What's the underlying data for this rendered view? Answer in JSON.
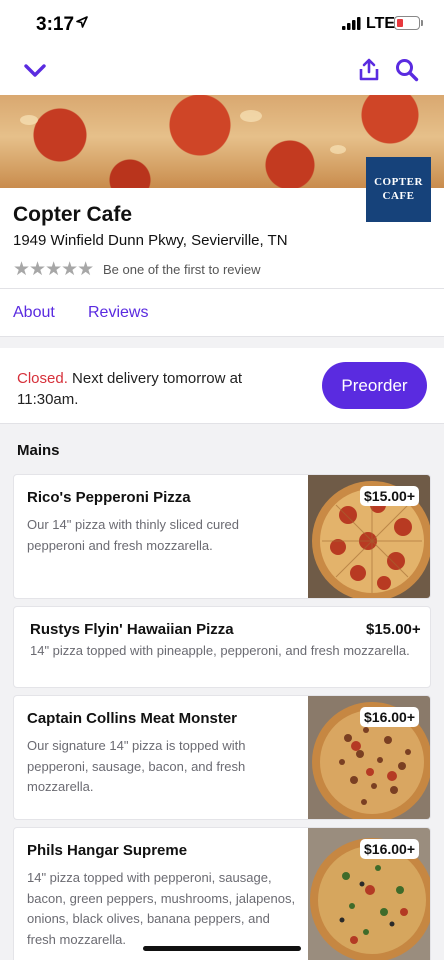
{
  "status_bar": {
    "time": "3:17",
    "network": "LTE",
    "battery_color": "#e8383d"
  },
  "nav": {
    "back_icon": "chevron-down-icon",
    "share_icon": "share-icon",
    "search_icon": "search-icon"
  },
  "restaurant": {
    "name": "Copter Cafe",
    "address": "1949 Winfield Dunn Pkwy, Sevierville, TN",
    "stars_display": "★★★★★",
    "rating_filled": 0,
    "rating_max": 5,
    "review_cta": "Be one of the first to review",
    "logo_line1": "COPTER",
    "logo_line2": "CAFE"
  },
  "tabs": [
    {
      "label": "About"
    },
    {
      "label": "Reviews"
    }
  ],
  "delivery": {
    "status": "Closed.",
    "message": " Next delivery tomorrow at 11:30am.",
    "cta": "Preorder"
  },
  "menu": {
    "section": "Mains",
    "items": [
      {
        "name": "Rico's Pepperoni Pizza",
        "description": "Our 14\" pizza with thinly sliced cured pepperoni and fresh mozzarella.",
        "price": "$15.00+"
      },
      {
        "name": "Rustys Flyin' Hawaiian Pizza",
        "description": "14\" pizza topped with pineapple, pepperoni, and fresh mozzarella.",
        "price": "$15.00+"
      },
      {
        "name": "Captain Collins Meat Monster",
        "description": "Our signature 14\" pizza is topped with pepperoni, sausage, bacon, and fresh mozzarella.",
        "price": "$16.00+"
      },
      {
        "name": "Phils Hangar Supreme",
        "description": "14\" pizza topped with pepperoni, sausage, bacon, green peppers, mushrooms, jalapenos, onions, black olives, banana peppers, and fresh mozzarella.",
        "price": "$16.00+"
      }
    ]
  },
  "colors": {
    "accent": "#5a2be0",
    "closed": "#d6303a",
    "logo_bg": "#16427a"
  }
}
